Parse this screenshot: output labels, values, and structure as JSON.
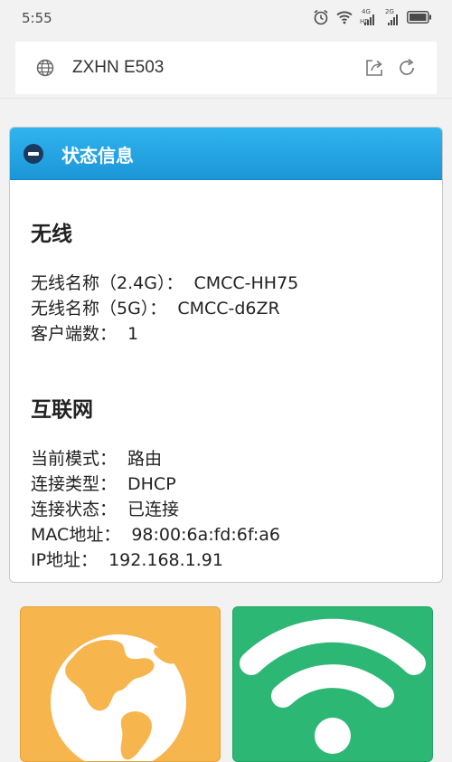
{
  "status_bar": {
    "time": "5:55",
    "network_4g": "4G",
    "network_hd": "HD",
    "network_2g": "2G",
    "icons": [
      "alarm-icon",
      "wifi-icon",
      "signal-4g-icon",
      "signal-2g-icon",
      "battery-icon"
    ]
  },
  "address_bar": {
    "title": "ZXHN E503",
    "icons": [
      "globe-icon",
      "share-icon",
      "reload-icon"
    ]
  },
  "status_panel": {
    "title": "状态信息",
    "wireless": {
      "heading": "无线",
      "ssid_24_label": "无线名称（2.4G）：",
      "ssid_24_value": "CMCC-HH75",
      "ssid_5_label": "无线名称（5G）：",
      "ssid_5_value": "CMCC-d6ZR",
      "clients_label": "客户端数：",
      "clients_value": "1"
    },
    "internet": {
      "heading": "互联网",
      "mode_label": "当前模式：",
      "mode_value": "路由",
      "conn_type_label": "连接类型：",
      "conn_type_value": "DHCP",
      "conn_state_label": "连接状态：",
      "conn_state_value": "已连接",
      "mac_label": "MAC地址：",
      "mac_value": "98:00:6a:fd:6f:a6",
      "ip_label": "IP地址：",
      "ip_value": "192.168.1.91"
    }
  },
  "tiles": [
    {
      "icon": "globe-icon",
      "color": "#f7b54e"
    },
    {
      "icon": "wifi-icon",
      "color": "#2db774"
    }
  ],
  "colors": {
    "header_blue": "#1b96d8",
    "internet_orange": "#f7b54e",
    "wireless_green": "#2db774"
  }
}
